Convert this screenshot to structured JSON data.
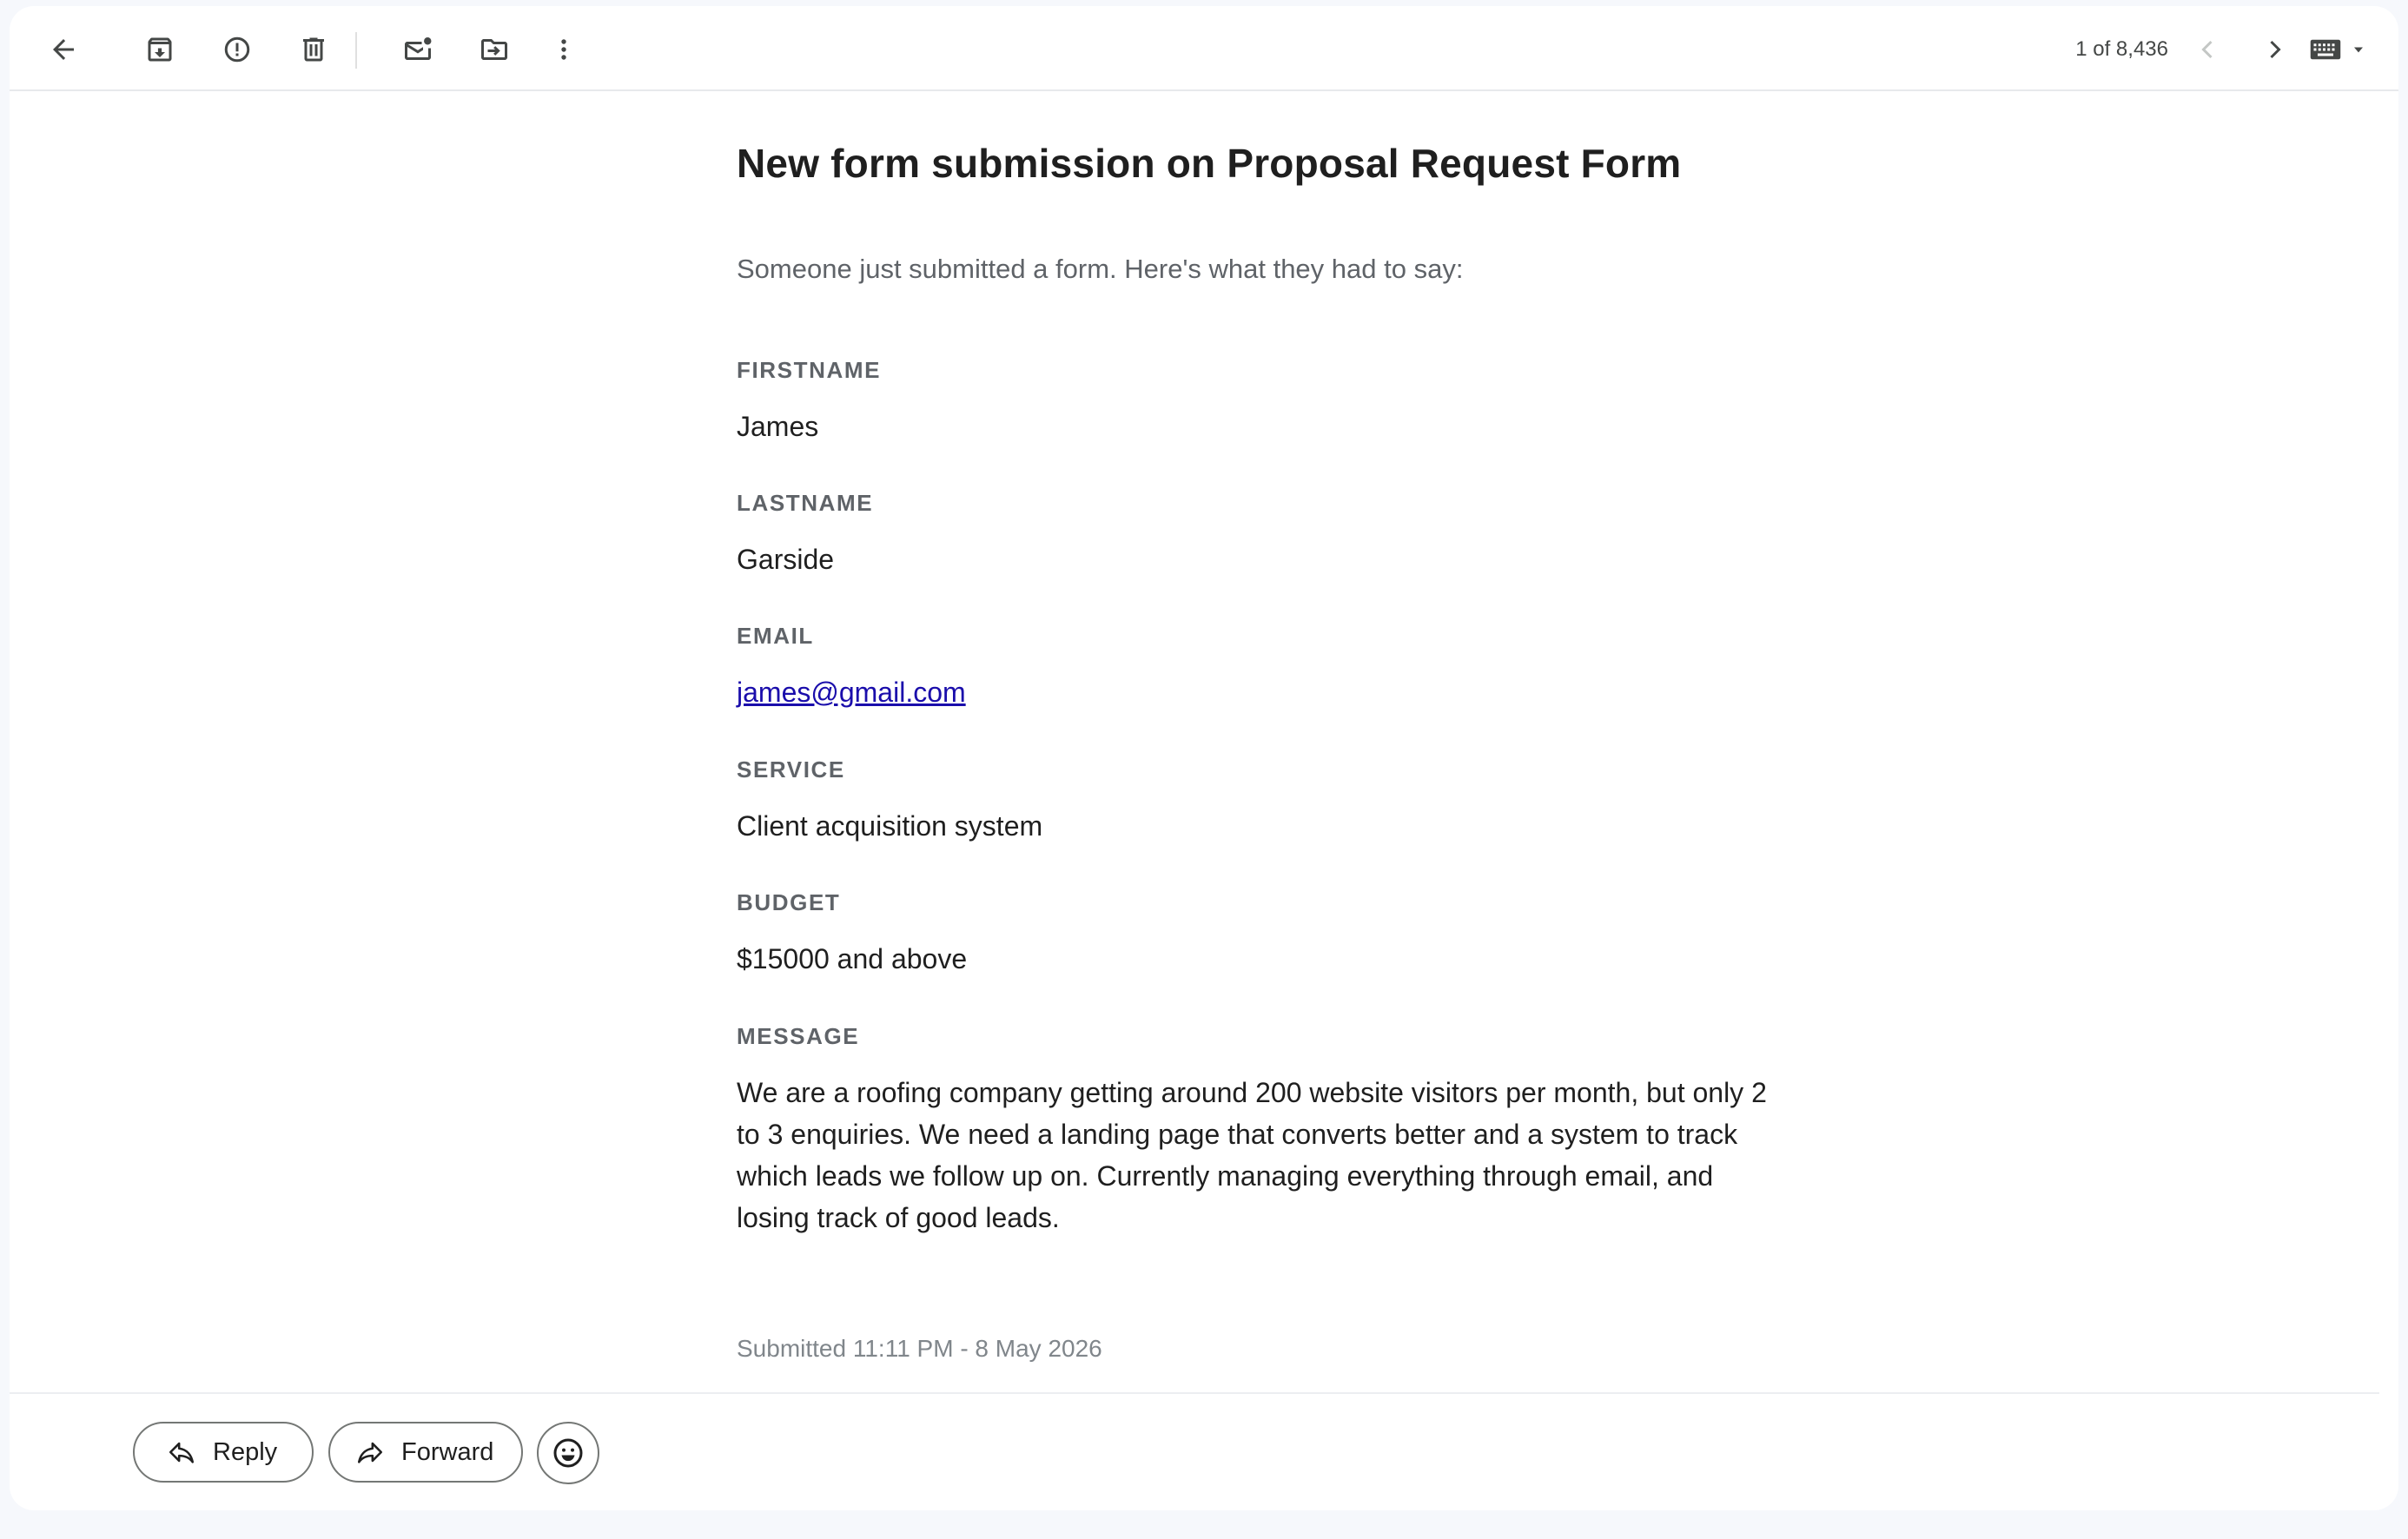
{
  "toolbar": {
    "icons": {
      "back": "back-arrow-icon",
      "archive": "archive-icon",
      "spam": "report-spam-icon",
      "delete": "trash-icon",
      "unread": "mark-unread-icon",
      "move": "move-to-folder-icon",
      "more": "more-vert-icon",
      "prev": "chevron-left-icon",
      "next": "chevron-right-icon",
      "keyboard": "keyboard-icon"
    },
    "pager": "1 of 8,436"
  },
  "email": {
    "subject": "New form submission on Proposal Request Form",
    "intro": "Someone just submitted a form. Here's what they had to say:",
    "fields": [
      {
        "label": "FIRSTNAME",
        "value": "James"
      },
      {
        "label": "LASTNAME",
        "value": "Garside"
      },
      {
        "label": "EMAIL",
        "value": "james@gmail.com"
      },
      {
        "label": "SERVICE",
        "value": "Client acquisition system"
      },
      {
        "label": "BUDGET",
        "value": "$15000 and above"
      },
      {
        "label": "MESSAGE",
        "value": "We are a roofing company getting around 200 website visitors per month, but only 2 to 3 enquiries. We need a landing page that converts better and a system to track which leads we follow up on. Currently managing everything through email, and losing track of good leads."
      }
    ],
    "submitted": "Submitted 11:11 PM - 8 May 2026"
  },
  "footer": {
    "reply_label": "Reply",
    "forward_label": "Forward",
    "emoji_icon": "emoji-reaction-icon"
  },
  "colors": {
    "link": "#1a0dab",
    "label": "#5f6368",
    "text": "#1f1f1f"
  }
}
